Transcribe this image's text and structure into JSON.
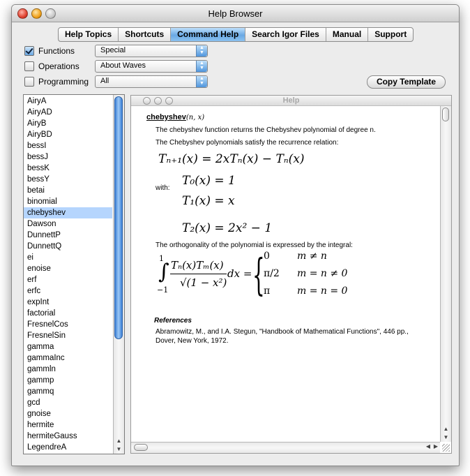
{
  "window": {
    "title": "Help Browser"
  },
  "tabs": [
    {
      "label": "Help Topics",
      "selected": false
    },
    {
      "label": "Shortcuts",
      "selected": false
    },
    {
      "label": "Command Help",
      "selected": true
    },
    {
      "label": "Search Igor Files",
      "selected": false
    },
    {
      "label": "Manual",
      "selected": false
    },
    {
      "label": "Support",
      "selected": false
    }
  ],
  "filters": [
    {
      "label": "Functions",
      "checked": true,
      "select_value": "Special"
    },
    {
      "label": "Operations",
      "checked": false,
      "select_value": "About Waves"
    },
    {
      "label": "Programming",
      "checked": false,
      "select_value": "All"
    }
  ],
  "copy_template_label": "Copy Template",
  "list": {
    "items": [
      "AiryA",
      "AiryAD",
      "AiryB",
      "AiryBD",
      "bessI",
      "bessJ",
      "bessK",
      "bessY",
      "betai",
      "binomial",
      "chebyshev",
      "Dawson",
      "DunnettP",
      "DunnettQ",
      "ei",
      "enoise",
      "erf",
      "erfc",
      "expInt",
      "factorial",
      "FresnelCos",
      "FresnelSin",
      "gamma",
      "gammaInc",
      "gammln",
      "gammp",
      "gammq",
      "gcd",
      "gnoise",
      "hermite",
      "hermiteGauss",
      "LegendreA"
    ],
    "selected": "chebyshev",
    "scroll_position": 0.0,
    "visible_fraction": 0.72
  },
  "help": {
    "pane_title": "Help",
    "func_name": "chebyshev",
    "func_args": "(n, x)",
    "desc1": "The chebyshev function returns the Chebyshev polynomial of degree n.",
    "desc2": "The Chebyshev polynomials satisfy the recurrence relation:",
    "eq_recurrence": "Tₙ₊₁(x) = 2xTₙ(x) − Tₙ(x)",
    "with_label": "with:",
    "eq_t0": "T₀(x) = 1",
    "eq_t1": "T₁(x) = x",
    "eq_t2": "T₂(x) = 2x² − 1",
    "ortho_text": "The orthogonality of the polynomial is expressed by the integral:",
    "integral_upper": "1",
    "integral_lower": "−1",
    "integral_numer": "Tₙ(x)Tₘ(x)",
    "integral_denom": "√(1 − x²)",
    "integral_dx": "dx =",
    "case1_val": "0",
    "case1_cond": "m ≠ n",
    "case2_val": "π/2",
    "case2_cond": "m = n ≠ 0",
    "case3_val": "π",
    "case3_cond": "m = n = 0",
    "refs_heading": "References",
    "ref_line1": "Abramowitz, M., and I.A. Stegun, \"Handbook of Mathematical Functions\", 446 pp.,",
    "ref_line2": "Dover, New York, 1972."
  }
}
